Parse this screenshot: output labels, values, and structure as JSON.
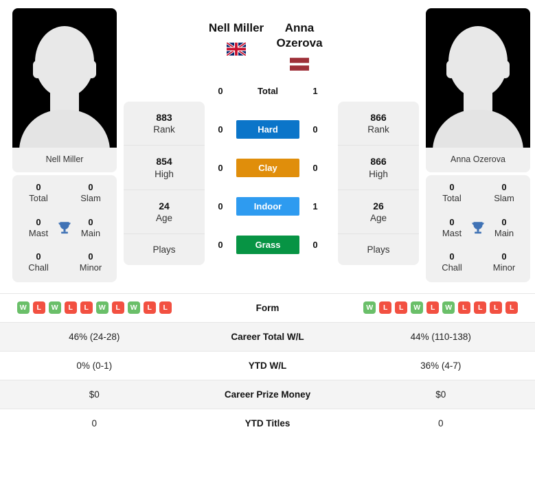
{
  "players": {
    "left": {
      "name": "Nell Miller",
      "caption": "Nell Miller",
      "flag": "gb-flag",
      "flag_country": "United Kingdom",
      "rank": "883",
      "rank_label": "Rank",
      "high": "854",
      "high_label": "High",
      "age": "24",
      "age_label": "Age",
      "plays_label": "Plays",
      "plays_value": "",
      "titles": {
        "total": "0",
        "total_label": "Total",
        "slam": "0",
        "slam_label": "Slam",
        "mast": "0",
        "mast_label": "Mast",
        "main": "0",
        "main_label": "Main",
        "chall": "0",
        "chall_label": "Chall",
        "minor": "0",
        "minor_label": "Minor"
      },
      "form": [
        "W",
        "L",
        "W",
        "L",
        "L",
        "W",
        "L",
        "W",
        "L",
        "L"
      ],
      "career_wl": "46% (24-28)",
      "ytd_wl": "0% (0-1)",
      "career_prize": "$0",
      "ytd_titles": "0"
    },
    "right": {
      "name": "Anna Ozerova",
      "name_line1": "Anna",
      "name_line2": "Ozerova",
      "caption": "Anna Ozerova",
      "flag": "lv-flag",
      "flag_country": "Latvia",
      "rank": "866",
      "rank_label": "Rank",
      "high": "866",
      "high_label": "High",
      "age": "26",
      "age_label": "Age",
      "plays_label": "Plays",
      "plays_value": "",
      "titles": {
        "total": "0",
        "total_label": "Total",
        "slam": "0",
        "slam_label": "Slam",
        "mast": "0",
        "mast_label": "Mast",
        "main": "0",
        "main_label": "Main",
        "chall": "0",
        "chall_label": "Chall",
        "minor": "0",
        "minor_label": "Minor"
      },
      "form": [
        "W",
        "L",
        "L",
        "W",
        "L",
        "W",
        "L",
        "L",
        "L",
        "L"
      ],
      "career_wl": "44% (110-138)",
      "ytd_wl": "36% (4-7)",
      "career_prize": "$0",
      "ytd_titles": "0"
    }
  },
  "head_to_head": {
    "total": {
      "label": "Total",
      "left": "0",
      "right": "1"
    },
    "surfaces": [
      {
        "label": "Hard",
        "left": "0",
        "right": "0",
        "color": "#0b75c9"
      },
      {
        "label": "Clay",
        "left": "0",
        "right": "0",
        "color": "#e08e0b"
      },
      {
        "label": "Indoor",
        "left": "0",
        "right": "1",
        "color": "#2e9bf0"
      },
      {
        "label": "Grass",
        "left": "0",
        "right": "0",
        "color": "#079444"
      }
    ]
  },
  "comparison_table": {
    "rows": [
      {
        "label": "Form",
        "left": "",
        "right": "",
        "type": "form"
      },
      {
        "label": "Career Total W/L",
        "left": "46% (24-28)",
        "right": "44% (110-138)",
        "type": "text"
      },
      {
        "label": "YTD W/L",
        "left": "0% (0-1)",
        "right": "36% (4-7)",
        "type": "text"
      },
      {
        "label": "Career Prize Money",
        "left": "$0",
        "right": "$0",
        "type": "text"
      },
      {
        "label": "YTD Titles",
        "left": "0",
        "right": "0",
        "type": "text"
      }
    ]
  },
  "colors": {
    "win": "#6abf69",
    "loss": "#f25041",
    "card_bg": "#f0f0f0",
    "row_alt": "#f4f4f4"
  }
}
